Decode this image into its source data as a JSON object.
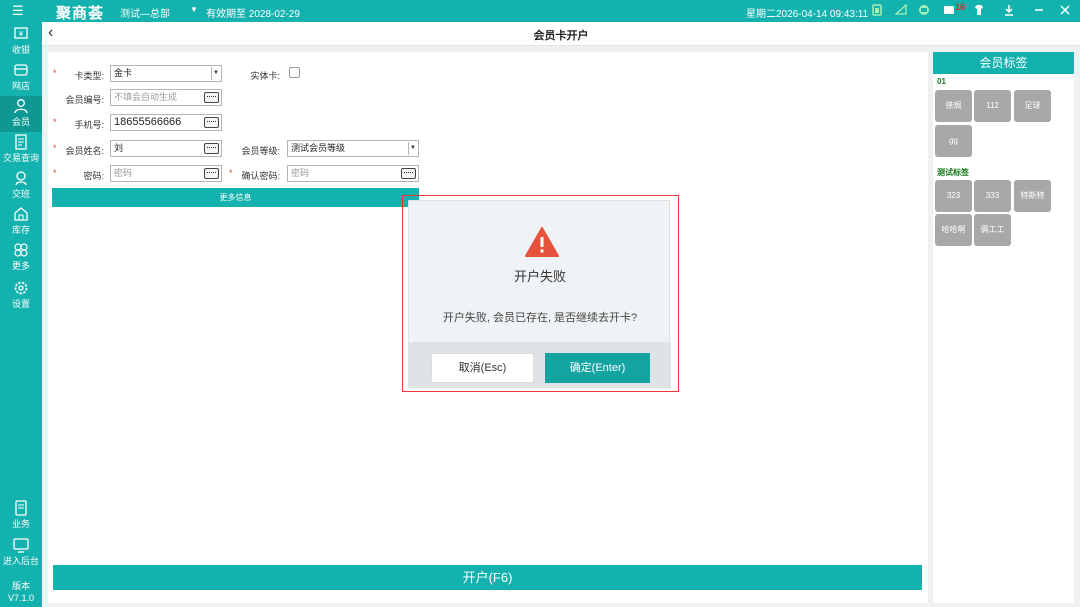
{
  "topbar": {
    "menu_icon": "☰",
    "logo": "聚商荟",
    "store": "测试—总部",
    "expiry": "有效期至 2028-02-29",
    "datetime": "星期二2026-04-14 09:43:11",
    "badge_count": "16",
    "icons": [
      "battery-icon",
      "wifi-icon",
      "face-icon",
      "message-icon",
      "shirt-icon",
      "download-icon",
      "minimize-icon",
      "close-icon"
    ]
  },
  "sidebar": {
    "items": [
      {
        "label": "收银",
        "icon": "cashier-icon"
      },
      {
        "label": "网店",
        "icon": "store-icon"
      },
      {
        "label": "会员",
        "icon": "member-icon"
      },
      {
        "label": "交易查询",
        "icon": "transaction-icon"
      },
      {
        "label": "交班",
        "icon": "shift-icon"
      },
      {
        "label": "库存",
        "icon": "inventory-icon"
      },
      {
        "label": "更多",
        "icon": "more-icon"
      },
      {
        "label": "设置",
        "icon": "settings-icon"
      },
      {
        "label": "业务",
        "icon": "business-icon"
      },
      {
        "label": "进入后台",
        "icon": "backend-icon"
      }
    ],
    "version_label": "版本",
    "version": "V7.1.0"
  },
  "header": {
    "title": "会员卡开户"
  },
  "form": {
    "card_type_label": "卡类型:",
    "card_type_value": "金卡",
    "physical_card_label": "实体卡:",
    "member_no_label": "会员编号:",
    "member_no_placeholder": "不填会自动生成",
    "phone_label": "手机号:",
    "phone_value": "18655566666",
    "name_label": "会员姓名:",
    "name_value": "刘",
    "level_label": "会员等级:",
    "level_value": "测试会员等级",
    "password_label": "密码:",
    "password_placeholder": "密码",
    "confirm_label": "确认密码:",
    "confirm_placeholder": "密码",
    "more_info": "更多信息",
    "open_button": "开户(F6)"
  },
  "tags_panel": {
    "title": "会员标签",
    "groups": [
      {
        "name": "01",
        "tags": [
          "搽焗",
          "112",
          "足球",
          "gg"
        ]
      },
      {
        "name": "测试标签",
        "tags": [
          "323",
          "333",
          "特斯特",
          "哈哈啊",
          "俩工工"
        ]
      }
    ]
  },
  "dialog": {
    "title": "开户失败",
    "message": "开户失败, 会员已存在, 是否继续去开卡?",
    "cancel": "取消(Esc)",
    "confirm": "确定(Enter)"
  },
  "colors": {
    "primary": "#13b2ae",
    "warning": "#e5533d",
    "highlight_border": "#e53935",
    "tag_bg": "#a8a8a8"
  }
}
